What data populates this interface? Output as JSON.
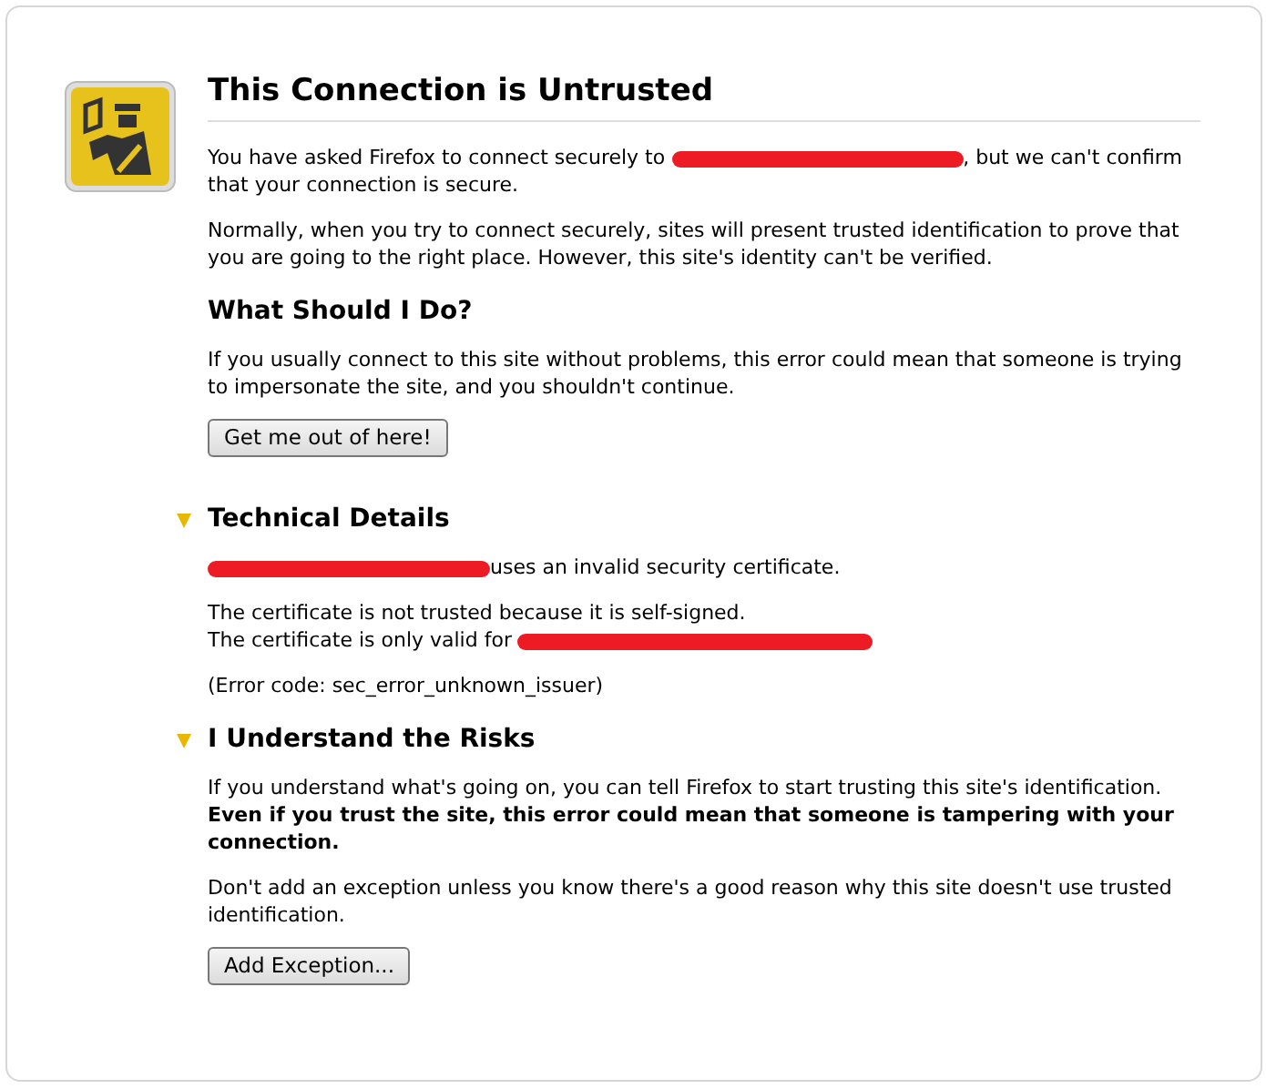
{
  "title": "This Connection is Untrusted",
  "intro": [
    [
      {
        "kind": "text",
        "text": "You have asked Firefox to connect securely to "
      },
      {
        "kind": "redaction"
      },
      {
        "kind": "text",
        "text": ", but we can't confirm that your connection is secure."
      }
    ],
    [
      {
        "kind": "text",
        "text": "Normally, when you try to connect securely, sites will present trusted identification to prove that you are going to the right place. However, this site's identity can't be verified."
      }
    ]
  ],
  "what_heading": "What Should I Do?",
  "what_text": "If you usually connect to this site without problems, this error could mean that someone is trying to impersonate the site, and you shouldn't continue.",
  "escape_button": "Get me out of here!",
  "sections": [
    {
      "heading": "Technical Details",
      "expanded": true,
      "paragraphs": [
        [
          {
            "kind": "redaction"
          },
          {
            "kind": "text",
            "text": "uses an invalid security certificate."
          }
        ],
        [
          {
            "kind": "text",
            "text": "The certificate is not trusted because it is self-signed."
          },
          {
            "kind": "break"
          },
          {
            "kind": "text",
            "text": "The certificate is only valid for "
          },
          {
            "kind": "redaction"
          }
        ],
        [
          {
            "kind": "text",
            "text": "(Error code: sec_error_unknown_issuer)"
          }
        ]
      ]
    },
    {
      "heading": "I Understand the Risks",
      "expanded": true,
      "paragraphs": [
        [
          {
            "kind": "text",
            "text": "If you understand what's going on, you can tell Firefox to start trusting this site's identification. **Even if you trust the site, this error could mean that someone is tampering with your connection.**"
          }
        ],
        [
          {
            "kind": "text",
            "text": "Don't add an exception unless you know there's a good reason why this site doesn't use trusted identification."
          }
        ]
      ],
      "button": "Add Exception..."
    }
  ]
}
